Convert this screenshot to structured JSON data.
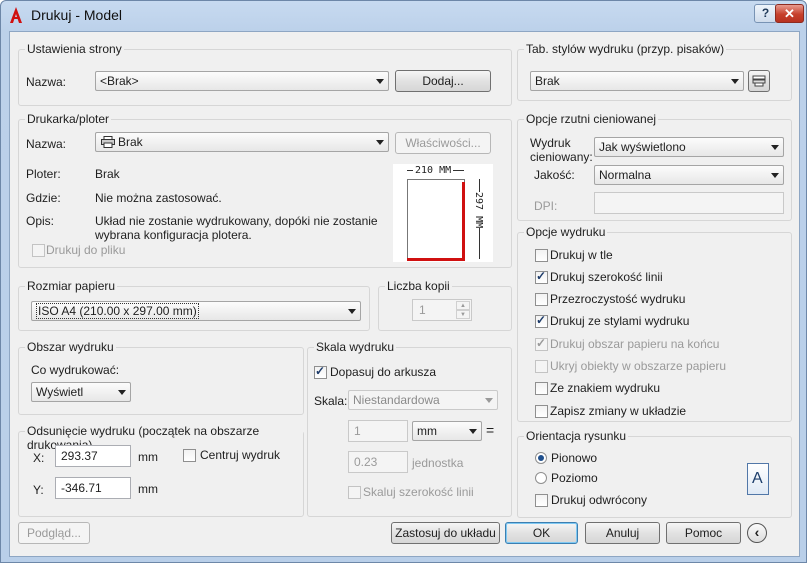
{
  "window": {
    "title": "Drukuj - Model",
    "help_label": "?",
    "close_label": "✕"
  },
  "page_setup": {
    "group_label": "Ustawienia strony",
    "name_label": "Nazwa:",
    "name_value": "<Brak>",
    "add_button": "Dodaj..."
  },
  "printer": {
    "group_label": "Drukarka/ploter",
    "name_label": "Nazwa:",
    "name_value": "Brak",
    "properties_button": "Właściwości...",
    "plotter_label": "Ploter:",
    "plotter_value": "Brak",
    "where_label": "Gdzie:",
    "where_value": "Nie można zastosować.",
    "desc_label": "Opis:",
    "desc_value_1": "Układ nie zostanie wydrukowany, dopóki nie zostanie",
    "desc_value_2": "wybrana konfiguracja plotera.",
    "print_to_file": "Drukuj do pliku",
    "preview_width": "210 MM",
    "preview_height": "297 MM"
  },
  "paper_size": {
    "group_label": "Rozmiar papieru",
    "value": "ISO A4 (210.00 x 297.00 mm)"
  },
  "copies": {
    "group_label": "Liczba kopii",
    "value": "1"
  },
  "plot_area": {
    "group_label": "Obszar wydruku",
    "what_label": "Co wydrukować:",
    "what_value": "Wyświetl"
  },
  "plot_offset": {
    "group_label": "Odsunięcie wydruku (początek na obszarze drukowania)",
    "x_label": "X:",
    "x_value": "293.37",
    "x_unit": "mm",
    "y_label": "Y:",
    "y_value": "-346.71",
    "y_unit": "mm",
    "center_label": "Centruj wydruk"
  },
  "plot_scale": {
    "group_label": "Skala wydruku",
    "fit_label": "Dopasuj do arkusza",
    "scale_label": "Skala:",
    "scale_value": "Niestandardowa",
    "value1": "1",
    "unit_value": "mm",
    "equals": "=",
    "value2": "0.23",
    "unit2": "jednostka",
    "lineweights_label": "Skaluj szerokość linii"
  },
  "plot_style_table": {
    "group_label": "Tab. stylów wydruku (przyp. pisaków)",
    "value": "Brak"
  },
  "shaded_viewport": {
    "group_label": "Opcje rzutni cieniowanej",
    "shade_label_1": "Wydruk",
    "shade_label_2": "cieniowany:",
    "shade_value": "Jak wyświetlono",
    "quality_label": "Jakość:",
    "quality_value": "Normalna",
    "dpi_label": "DPI:"
  },
  "plot_options": {
    "group_label": "Opcje wydruku",
    "items": [
      {
        "label": "Drukuj w tle",
        "checked": false,
        "enabled": true
      },
      {
        "label": "Drukuj szerokość linii",
        "checked": true,
        "enabled": true
      },
      {
        "label": "Przezroczystość wydruku",
        "checked": false,
        "enabled": true
      },
      {
        "label": "Drukuj ze stylami wydruku",
        "checked": true,
        "enabled": true
      },
      {
        "label": "Drukuj obszar papieru na końcu",
        "checked": true,
        "enabled": false
      },
      {
        "label": "Ukryj obiekty w obszarze papieru",
        "checked": false,
        "enabled": false
      },
      {
        "label": "Ze znakiem wydruku",
        "checked": false,
        "enabled": true
      },
      {
        "label": "Zapisz zmiany w układzie",
        "checked": false,
        "enabled": true
      }
    ]
  },
  "orientation": {
    "group_label": "Orientacja rysunku",
    "portrait": "Pionowo",
    "landscape": "Poziomo",
    "upside_down": "Drukuj odwrócony",
    "icon_letter": "A"
  },
  "footer": {
    "preview_button": "Podgląd...",
    "apply_button": "Zastosuj do układu",
    "ok_button": "OK",
    "cancel_button": "Anuluj",
    "help_button": "Pomoc",
    "collapse_icon": "‹"
  },
  "colors": {
    "accent_red": "#d01010",
    "title_blue": "#c7daf0"
  }
}
